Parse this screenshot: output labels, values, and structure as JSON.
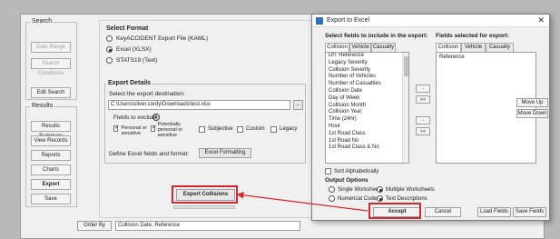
{
  "left_panel": {
    "search_label": "Search",
    "date_range_button": "Date Range",
    "search_conditions_button": "Search Conditions",
    "edit_search_button": "Edit Search",
    "results_label": "Results",
    "results_summary_button": "Results Summary",
    "view_records_button": "View Records",
    "reports_button": "Reports",
    "charts_button": "Charts",
    "export_button": "Export",
    "save_button": "Save"
  },
  "format_section": {
    "title": "Select Format",
    "options": [
      "KeyACCIDENT Export File (KAML)",
      "Excel (XLSX)",
      "STATS19 (Text)"
    ],
    "selected_index": 1
  },
  "export_details": {
    "title": "Export Details",
    "destination_label": "Select the export destination:",
    "destination_value": "C:\\Users\\oliver.cordy\\Downloads\\test.xlsx",
    "browse_button": "...",
    "fields_to_exclude_label": "Fields to exclude",
    "info_icon": "info-icon",
    "exclude_options": [
      {
        "label": "Personal or sensitive",
        "checked": true
      },
      {
        "label": "Potentially personal or sensitive",
        "checked": true
      },
      {
        "label": "Subjective",
        "checked": false
      },
      {
        "label": "Custom",
        "checked": false
      },
      {
        "label": "Legacy",
        "checked": false
      }
    ],
    "define_label": "Define Excel fields and format:",
    "excel_formatting_button": "Excel Formatting"
  },
  "export_collisions_button": "Export Collisions",
  "order_by_button": "Order By",
  "order_by_value": "Collision Date, Reference",
  "dialog": {
    "title": "Export to Excel",
    "left_heading": "Select fields to include in the export:",
    "right_heading": "Fields selected for export:",
    "tabs": [
      "Collision",
      "Vehicle",
      "Casualty"
    ],
    "available_fields": [
      "DfT Reference",
      "Legacy Severity",
      "Collision Severity",
      "Number of Vehicles",
      "Number of Casualties",
      "Collision Date",
      "Day of Week",
      "Collision Month",
      "Collision Year",
      "Time (24hr)",
      "Hour",
      "1st Road Class",
      "1st Road No",
      "1st Road Class & No"
    ],
    "selected_fields": [
      "Reference"
    ],
    "move_buttons": [
      "-",
      ">>",
      "-",
      "<<"
    ],
    "sort_label": "Sort Alphabetically",
    "output_options_title": "Output Options",
    "output_options": [
      {
        "label": "Single Worksheet",
        "selected": false
      },
      {
        "label": "Multiple Worksheets",
        "selected": true
      },
      {
        "label": "Numerical Codes",
        "selected": false
      },
      {
        "label": "Text Descriptions",
        "selected": true
      }
    ],
    "move_up_button": "Move Up",
    "move_down_button": "Move Down",
    "accept_button": "Accept",
    "cancel_button": "Cancel",
    "load_fields_button": "Load Fields",
    "save_fields_button": "Save Fields"
  },
  "colors": {
    "highlight": "#d6262e",
    "dialog_icon": "#2d6fb8"
  }
}
